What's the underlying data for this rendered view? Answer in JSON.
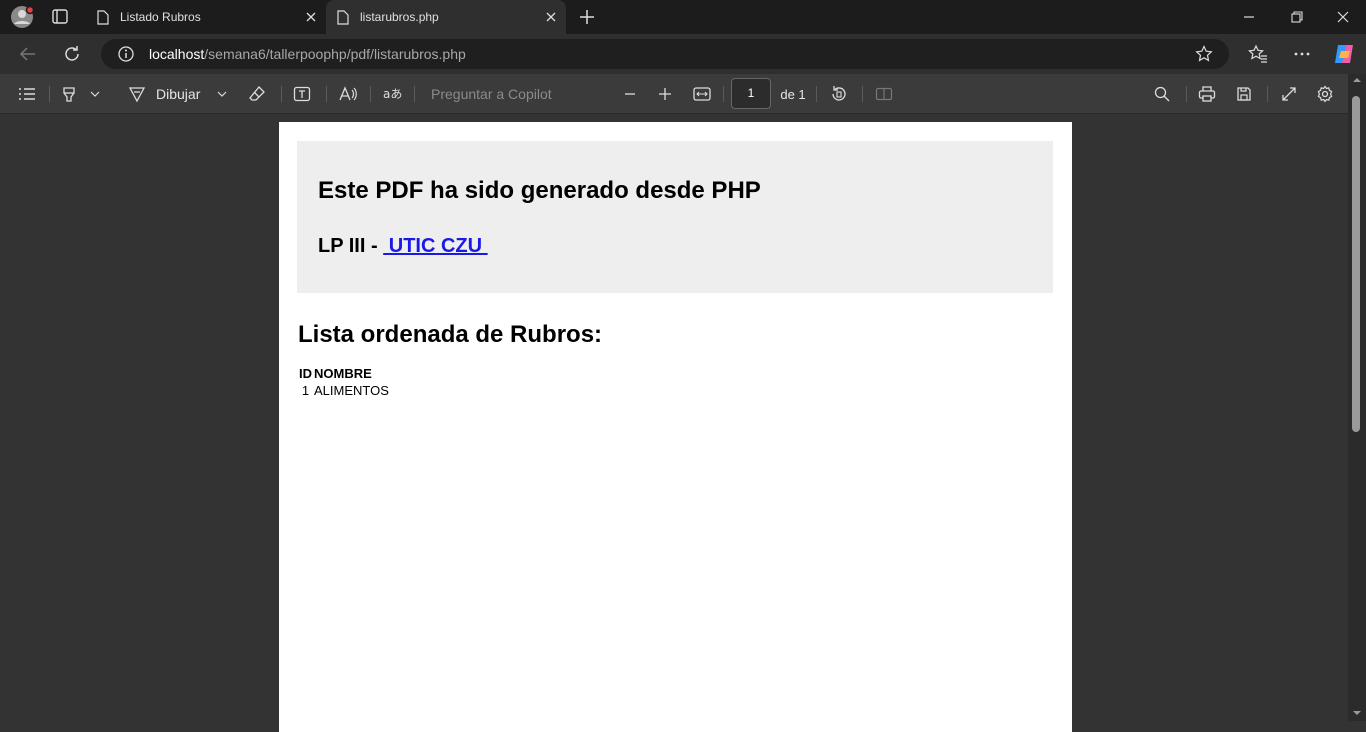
{
  "browser": {
    "tabs": [
      {
        "title": "Listado Rubros",
        "active": false
      },
      {
        "title": "listarubros.php",
        "active": true
      }
    ],
    "address": {
      "host": "localhost",
      "path": "/semana6/tallerpoophp/pdf/listarubros.php"
    }
  },
  "pdf_toolbar": {
    "draw_label": "Dibujar",
    "copilot_placeholder": "Preguntar a Copilot",
    "page_current": "1",
    "page_total_label": "de 1"
  },
  "document": {
    "title": "Este PDF ha sido generado desde PHP",
    "subtitle_prefix": "LP III - ",
    "subtitle_link": " UTIC CZU ",
    "list_heading": "Lista ordenada de Rubros:",
    "table": {
      "headers": [
        "ID",
        "NOMBRE"
      ],
      "rows": [
        {
          "id": "1",
          "nombre": "ALIMENTOS"
        }
      ]
    }
  },
  "colors": {
    "link": "#1a1ae6",
    "header_box": "#eeeeee"
  }
}
